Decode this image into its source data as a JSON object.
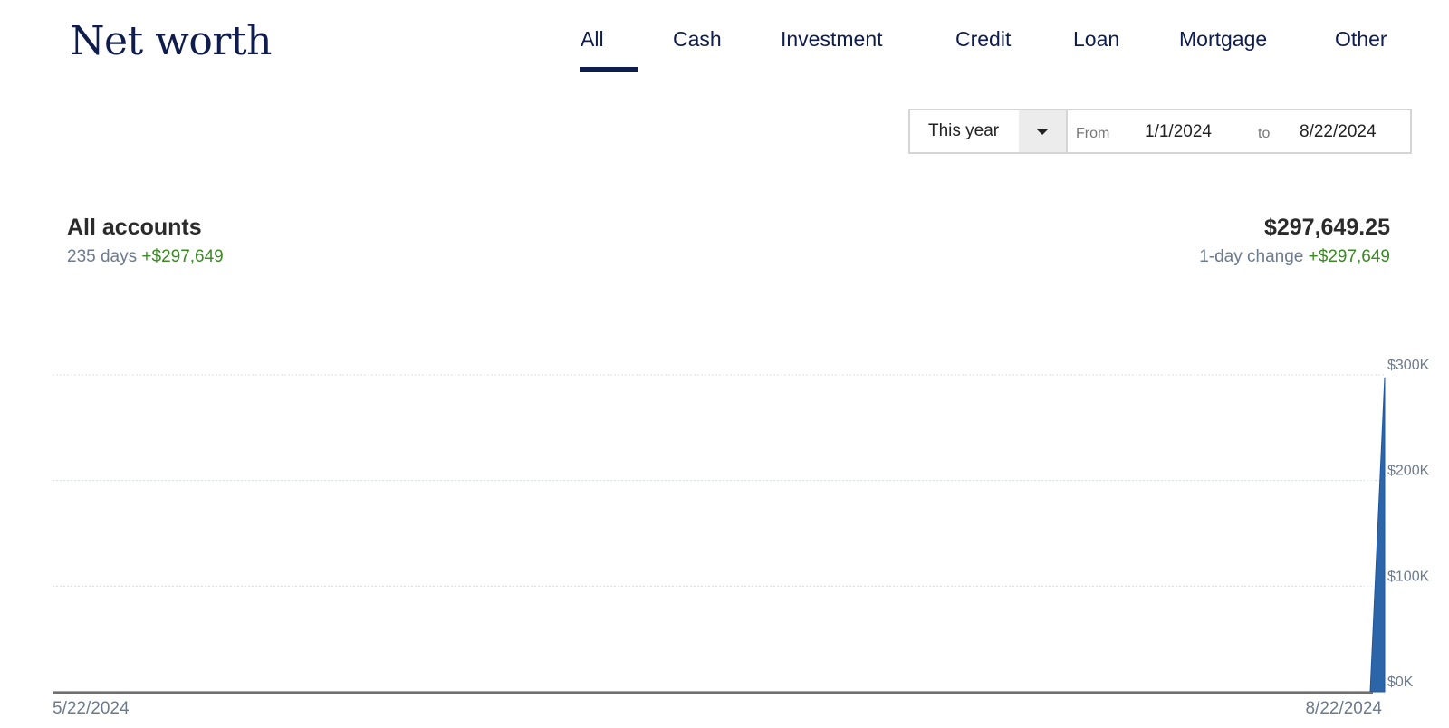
{
  "header": {
    "title": "Net worth"
  },
  "tabs": [
    {
      "label": "All",
      "active": true
    },
    {
      "label": "Cash",
      "active": false
    },
    {
      "label": "Investment",
      "active": false
    },
    {
      "label": "Credit",
      "active": false
    },
    {
      "label": "Loan",
      "active": false
    },
    {
      "label": "Mortgage",
      "active": false
    },
    {
      "label": "Other",
      "active": false
    }
  ],
  "date_range": {
    "preset": "This year",
    "from_label": "From",
    "from_value": "1/1/2024",
    "to_label": "to",
    "to_value": "8/22/2024"
  },
  "summary": {
    "title": "All accounts",
    "days": "235 days",
    "period_change": "+$297,649",
    "total": "$297,649.25",
    "day_change_label": "1-day change",
    "day_change": "+$297,649"
  },
  "colors": {
    "area": "#2c66a8",
    "positive": "#3a8a24",
    "title": "#0f1d4d"
  },
  "chart_data": {
    "type": "area",
    "title": "",
    "xlabel": "",
    "ylabel": "",
    "x_tick_labels": [
      "5/22/2024",
      "8/22/2024"
    ],
    "y_tick_labels": [
      "$0K",
      "$100K",
      "$200K",
      "$300K"
    ],
    "y_ticks": [
      0,
      100000,
      200000,
      300000
    ],
    "ylim": [
      0,
      300000
    ],
    "grid": true,
    "x_domain_days": [
      0,
      92
    ],
    "series": [
      {
        "name": "Net worth",
        "points": [
          [
            0,
            0
          ],
          [
            91,
            0
          ],
          [
            92,
            297649.25
          ]
        ]
      }
    ]
  }
}
